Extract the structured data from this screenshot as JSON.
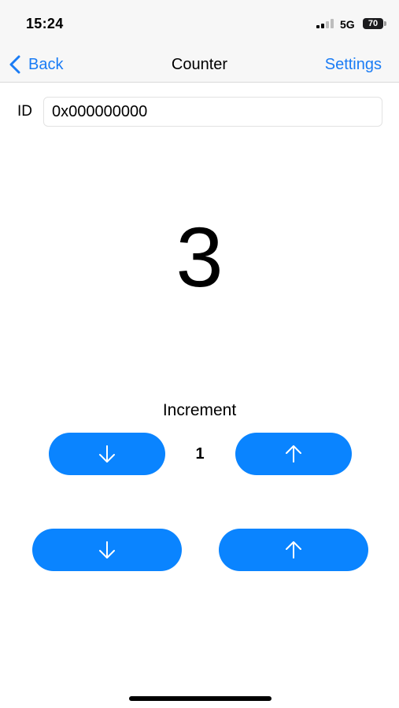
{
  "status_bar": {
    "time": "15:24",
    "network": "5G",
    "battery": "70"
  },
  "nav": {
    "back_label": "Back",
    "title": "Counter",
    "settings_label": "Settings"
  },
  "id_row": {
    "label": "ID",
    "value": "0x000000000"
  },
  "counter": {
    "value": "3"
  },
  "increment": {
    "label": "Increment",
    "value": "1"
  },
  "icons": {
    "back": "chevron-left-icon",
    "down": "arrow-down-icon",
    "up": "arrow-up-icon"
  },
  "colors": {
    "accent": "#0a84ff",
    "link": "#1a7cf5",
    "bar_background": "#f7f7f7"
  }
}
